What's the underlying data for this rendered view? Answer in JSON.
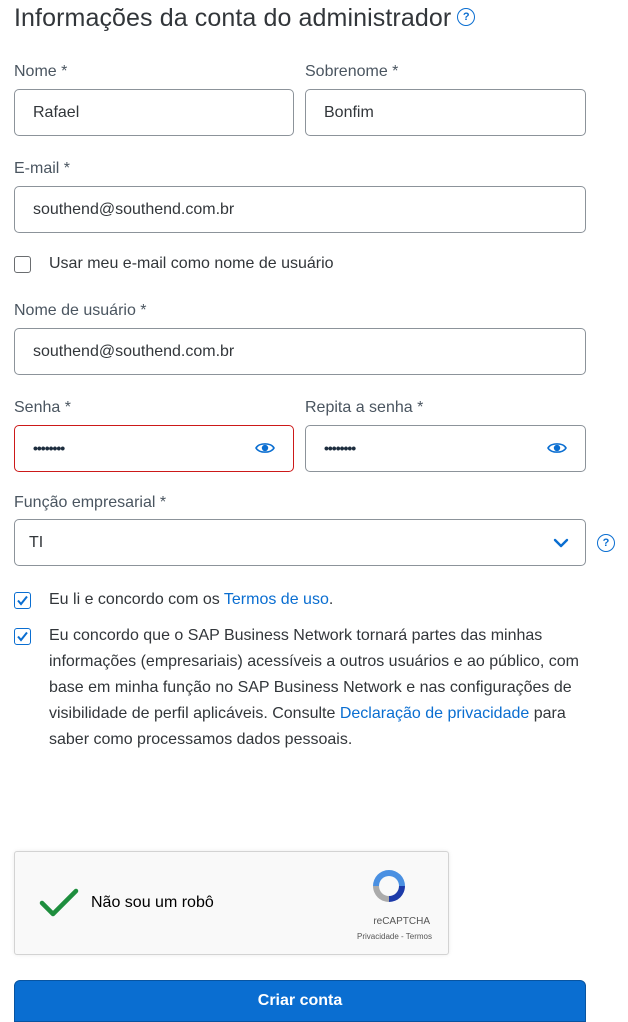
{
  "header": {
    "title": "Informações da conta do administrador",
    "help_icon": "question-circle-icon"
  },
  "form": {
    "first_name": {
      "label": "Nome *",
      "value": "Rafael"
    },
    "last_name": {
      "label": "Sobrenome *",
      "value": "Bonfim"
    },
    "email": {
      "label": "E-mail *",
      "value": "southend@southend.com.br"
    },
    "use_email_checkbox": {
      "label": "Usar meu e-mail como nome de usuário",
      "checked": false
    },
    "username": {
      "label": "Nome de usuário *",
      "value": "southend@southend.com.br"
    },
    "password": {
      "label": "Senha *",
      "masked_value": "••••••••",
      "state": "error",
      "icon": "eye-icon"
    },
    "repeat_password": {
      "label": "Repita a senha *",
      "masked_value": "••••••••",
      "icon": "eye-icon"
    },
    "business_role": {
      "label": "Função empresarial *",
      "selected": "TI",
      "icon": "chevron-down-icon"
    },
    "terms": {
      "text": "Eu li e concordo com os ",
      "link": "Termos de uso",
      "suffix": ".",
      "checked": true
    },
    "privacy": {
      "text": "Eu concordo que o SAP Business Network tornará partes das minhas informações (empresariais) acessíveis a outros usuários e ao público, com base em minha função no SAP Business Network e nas configurações de visibilidade de perfil aplicáveis. Consulte ",
      "link": "Declaração de privacidade",
      "suffix": " para saber como processamos dados pessoais.",
      "checked": true
    }
  },
  "captcha": {
    "label": "Não sou um robô",
    "brand": "reCAPTCHA",
    "links": "Privacidade - Termos",
    "checked": true
  },
  "submit": {
    "label": "Criar conta"
  },
  "colors": {
    "accent": "#0a6ed1",
    "error": "#cc1919",
    "success_check": "#1e8e3e"
  }
}
